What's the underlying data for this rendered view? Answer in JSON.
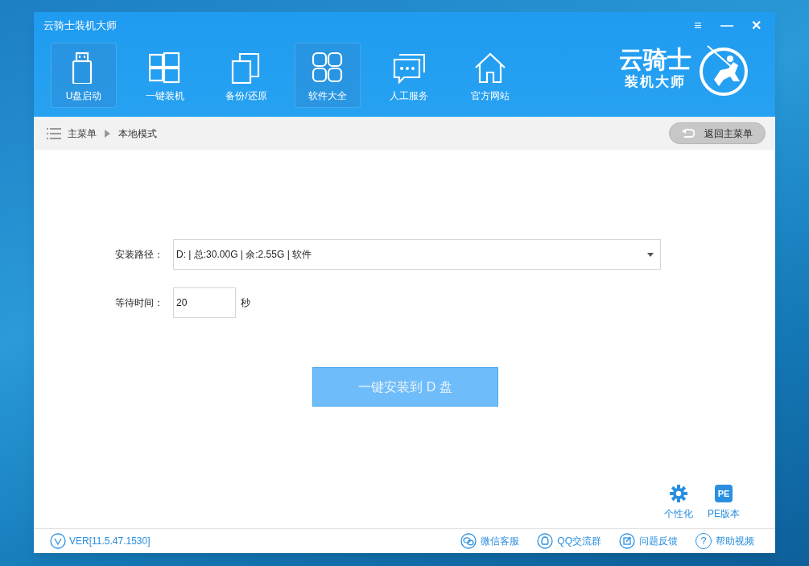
{
  "window": {
    "title": "云骑士装机大师",
    "controls": [
      "≡",
      "—",
      "✕"
    ]
  },
  "nav": [
    {
      "label": "U盘启动",
      "kind": "usb",
      "highlighted": true
    },
    {
      "label": "一键装机",
      "kind": "windows",
      "highlighted": false
    },
    {
      "label": "备份/还原",
      "kind": "copy",
      "highlighted": false
    },
    {
      "label": "软件大全",
      "kind": "apps",
      "highlighted": true
    },
    {
      "label": "人工服务",
      "kind": "chat",
      "highlighted": false
    },
    {
      "label": "官方网站",
      "kind": "home",
      "highlighted": false
    }
  ],
  "logo": {
    "line_1": "云骑士",
    "line_2": "装机大师"
  },
  "breadcrumb": {
    "items": [
      "主菜单",
      "本地模式"
    ],
    "back_button": "返回主菜单"
  },
  "form": {
    "path_label": "安装路径：",
    "path_value": "D: | 总:30.00G | 余:2.55G | 软件",
    "wait_label": "等待时间：",
    "wait_value": "20",
    "wait_unit": "秒",
    "install_button": "一键安装到 D 盘"
  },
  "corner_tools": [
    {
      "label": "个性化",
      "kind": "gear"
    },
    {
      "label": "PE版本",
      "kind": "pe",
      "icon_text": "PE"
    }
  ],
  "footer": {
    "version": "VER[11.5.47.1530]",
    "links": [
      {
        "label": "微信客服",
        "kind": "wechat"
      },
      {
        "label": "QQ交流群",
        "kind": "qq"
      },
      {
        "label": "问题反馈",
        "kind": "feedback"
      },
      {
        "label": "帮助视频",
        "kind": "help",
        "icon_text": "?"
      }
    ]
  }
}
